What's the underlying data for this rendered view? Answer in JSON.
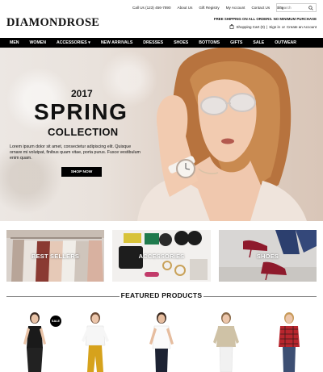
{
  "utility_nav": {
    "items": [
      "Call Us (123) 456-7890",
      "About Us",
      "Gift Registry",
      "My Account",
      "Contact Us",
      "Blog"
    ],
    "search_placeholder": "Search"
  },
  "brand": {
    "logo": "DIAMONDROSE"
  },
  "promo": {
    "shipping": "FREE SHIPPING ON ALL ORDERS. NO MINIMUM PURCHASE"
  },
  "account": {
    "cart": "Shopping Cart (0)",
    "separator": "|",
    "sign_in": "Sign in",
    "or": "or",
    "create": "Create an Account"
  },
  "main_nav": {
    "items": [
      "MEN",
      "WOMEN",
      "ACCESSORIES ▾",
      "NEW ARRIVALS",
      "DRESSES",
      "SHOES",
      "BOTTOMS",
      "GIFTS",
      "SALE",
      "OUTWEAR"
    ]
  },
  "hero": {
    "year": "2017",
    "title": "SPRING",
    "subtitle": "COLLECTION",
    "copy": "Lorem ipsum dolor sit amet, consectetur adipiscing elit. Quisque ornare mi volutpat, finibus quam vitae, porta purus. Fusce vestibulum enim quam.",
    "cta": "SHOP NOW"
  },
  "categories": [
    {
      "label": "BEST SELLERS"
    },
    {
      "label": "ACCESSORIES"
    },
    {
      "label": "SHOES"
    }
  ],
  "featured": {
    "title": "FEATURED PRODUCTS",
    "sale_badge": "SALE"
  },
  "colors": {
    "nav_bg": "#000000",
    "accent": "#111111",
    "hero_bg": "#e6dcd4"
  }
}
